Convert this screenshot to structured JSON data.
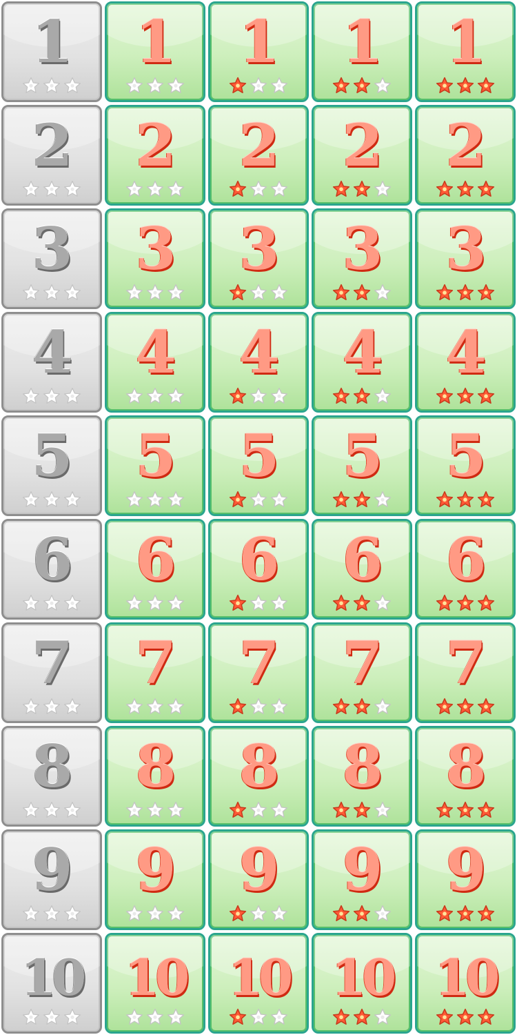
{
  "levels": [
    {
      "label": "1"
    },
    {
      "label": "2"
    },
    {
      "label": "3"
    },
    {
      "label": "4"
    },
    {
      "label": "5"
    },
    {
      "label": "6"
    },
    {
      "label": "7"
    },
    {
      "label": "8"
    },
    {
      "label": "9"
    },
    {
      "label": "10"
    }
  ],
  "variants": [
    {
      "state": "locked",
      "stars_earned": 0,
      "stars_max": 3
    },
    {
      "state": "unlocked",
      "stars_earned": 0,
      "stars_max": 3
    },
    {
      "state": "unlocked",
      "stars_earned": 1,
      "stars_max": 3
    },
    {
      "state": "unlocked",
      "stars_earned": 2,
      "stars_max": 3
    },
    {
      "state": "unlocked",
      "stars_earned": 3,
      "stars_max": 3
    }
  ],
  "icons": {
    "star_filled": "star-filled-icon",
    "star_empty": "star-empty-icon"
  },
  "colors": {
    "locked_border": "#8e8e8e",
    "unlocked_border": "#2aa58e",
    "number_fill": "#ff9a84",
    "number_outline": "#d02a12",
    "star_filled": "#ff5a36",
    "star_empty": "#ffffff"
  }
}
